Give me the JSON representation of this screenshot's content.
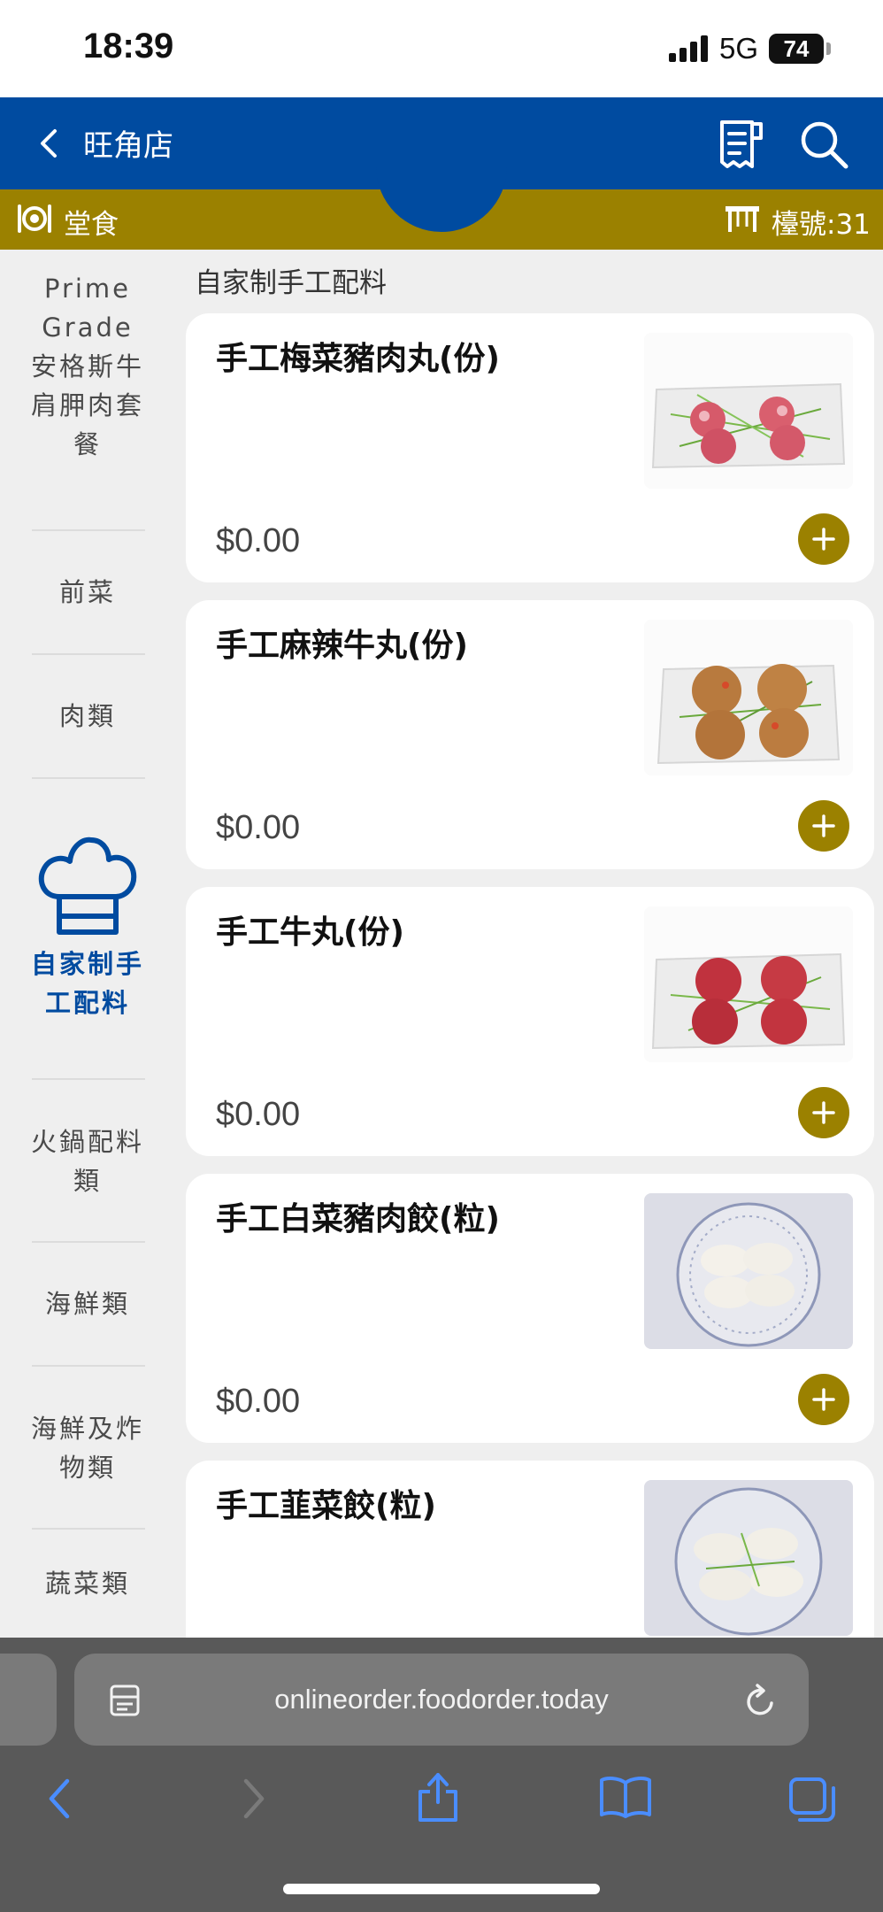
{
  "status_bar": {
    "time": "18:39",
    "network": "5G",
    "battery": "74"
  },
  "header": {
    "store_name": "旺角店",
    "back_icon": "chevron-left-icon",
    "receipt_icon": "receipt-icon",
    "search_icon": "search-icon",
    "color": "#004ba0"
  },
  "sub_header": {
    "dine_mode": "堂食",
    "table_label": "檯號:31",
    "color": "#9b8100"
  },
  "sidebar": {
    "items": [
      {
        "label": "Prime Grade 安格斯牛肩胛肉套餐"
      },
      {
        "label": "前菜"
      },
      {
        "label": "肉類"
      },
      {
        "label": "自家制手工配料",
        "icon": "chef-hat-icon",
        "active": true
      },
      {
        "label": "火鍋配料類"
      },
      {
        "label": "海鮮類"
      },
      {
        "label": "海鮮及炸物類"
      },
      {
        "label": "蔬菜類"
      }
    ]
  },
  "section": {
    "title": "自家制手工配料"
  },
  "menu_items": [
    {
      "name": "手工梅菜豬肉丸(份)",
      "price": "$0.00",
      "image": "pork-balls-photo"
    },
    {
      "name": "手工麻辣牛丸(份)",
      "price": "$0.00",
      "image": "spicy-beef-balls-photo"
    },
    {
      "name": "手工牛丸(份)",
      "price": "$0.00",
      "image": "beef-balls-photo"
    },
    {
      "name": "手工白菜豬肉餃(粒)",
      "price": "$0.00",
      "image": "cabbage-dumplings-photo"
    },
    {
      "name": "手工韮菜餃(粒)",
      "price": "",
      "image": "chive-dumplings-photo"
    }
  ],
  "browser": {
    "url": "onlineorder.foodorder.today",
    "icons": [
      "reader-icon",
      "reload-icon",
      "back-icon",
      "forward-icon",
      "share-icon",
      "bookmarks-icon",
      "tabs-icon"
    ]
  }
}
